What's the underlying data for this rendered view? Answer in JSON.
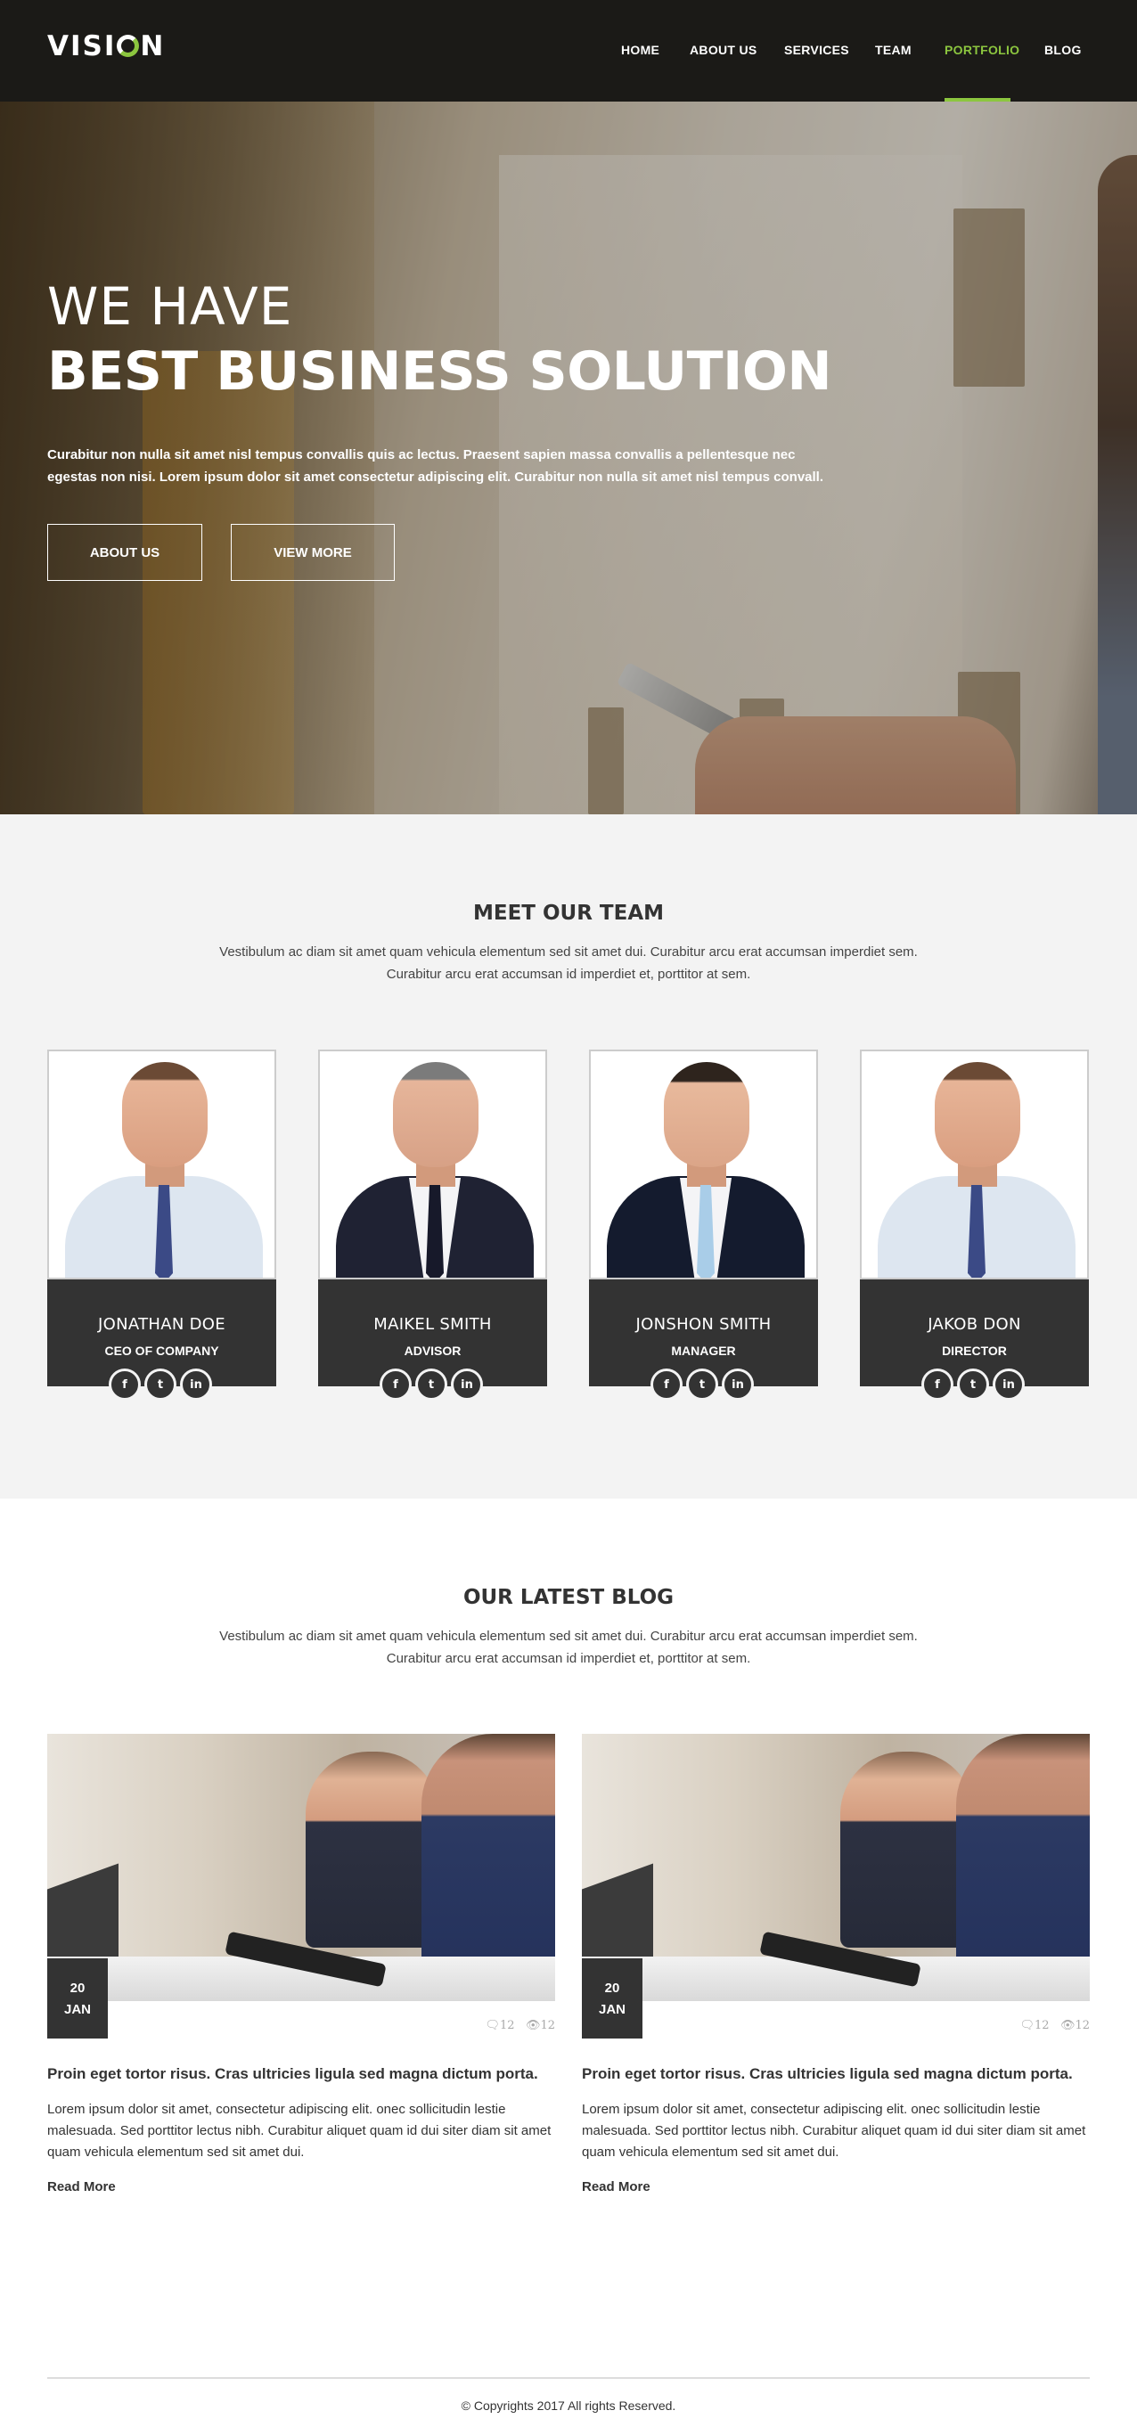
{
  "header": {
    "logo_prefix": "VISI",
    "logo_suffix": "N",
    "nav": [
      {
        "label": "HOME",
        "active": false
      },
      {
        "label": "ABOUT US",
        "active": false
      },
      {
        "label": "SERVICES",
        "active": false
      },
      {
        "label": "TEAM",
        "active": false
      },
      {
        "label": "PORTFOLIO",
        "active": true
      },
      {
        "label": "BLOG",
        "active": false
      }
    ]
  },
  "hero": {
    "subtitle": "WE HAVE",
    "title": "BEST BUSINESS SOLUTION",
    "text": "Curabitur non nulla sit amet nisl tempus convallis quis ac lectus. Praesent sapien massa convallis a pellentesque nec egestas non nisi. Lorem ipsum dolor sit amet consectetur adipiscing elit. Curabitur non nulla sit amet nisl tempus convall.",
    "buttons": [
      "ABOUT US",
      "VIEW MORE"
    ]
  },
  "team": {
    "title": "MEET OUR TEAM",
    "description": "Vestibulum ac diam sit amet quam vehicula elementum sed sit amet dui. Curabitur arcu erat accumsan imperdiet sem. Curabitur arcu erat accumsan id imperdiet et, porttitor at sem.",
    "members": [
      {
        "name": "JONATHAN DOE",
        "role": "CEO OF COMPANY"
      },
      {
        "name": "MAIKEL SMITH",
        "role": "ADVISOR"
      },
      {
        "name": "JONSHON SMITH",
        "role": "MANAGER"
      },
      {
        "name": "JAKOB DON",
        "role": "DIRECTOR"
      }
    ],
    "social_icons": [
      "facebook-icon",
      "twitter-icon",
      "linkedin-icon"
    ]
  },
  "blog": {
    "title": "OUR LATEST BLOG",
    "description": "Vestibulum ac diam sit amet quam vehicula elementum sed sit amet dui. Curabitur arcu erat accumsan imperdiet sem. Curabitur arcu erat accumsan id imperdiet et, porttitor at sem.",
    "posts": [
      {
        "day": "20",
        "month": "JAN",
        "comments": "12",
        "views": "12",
        "title": "Proin eget tortor risus. Cras ultricies ligula sed magna dictum porta.",
        "excerpt": "Lorem ipsum dolor sit amet, consectetur adipiscing elit. onec sollicitudin lestie malesuada. Sed porttitor lectus nibh. Curabitur aliquet quam id dui siter diam sit amet quam vehicula elementum sed sit amet dui.",
        "read_more": "Read More"
      },
      {
        "day": "20",
        "month": "JAN",
        "comments": "12",
        "views": "12",
        "title": "Proin eget tortor risus. Cras ultricies ligula sed magna dictum porta.",
        "excerpt": "Lorem ipsum dolor sit amet, consectetur adipiscing elit. onec sollicitudin lestie malesuada. Sed porttitor lectus nibh. Curabitur aliquet quam id dui siter diam sit amet quam vehicula elementum sed sit amet dui.",
        "read_more": "Read More"
      }
    ]
  },
  "footer": {
    "copyright": "© Copyrights 2017 All rights Reserved."
  },
  "colors": {
    "accent": "#8cc63f",
    "header_bg": "#1b1a17",
    "dark": "#333333",
    "section_bg": "#f3f3f3"
  }
}
